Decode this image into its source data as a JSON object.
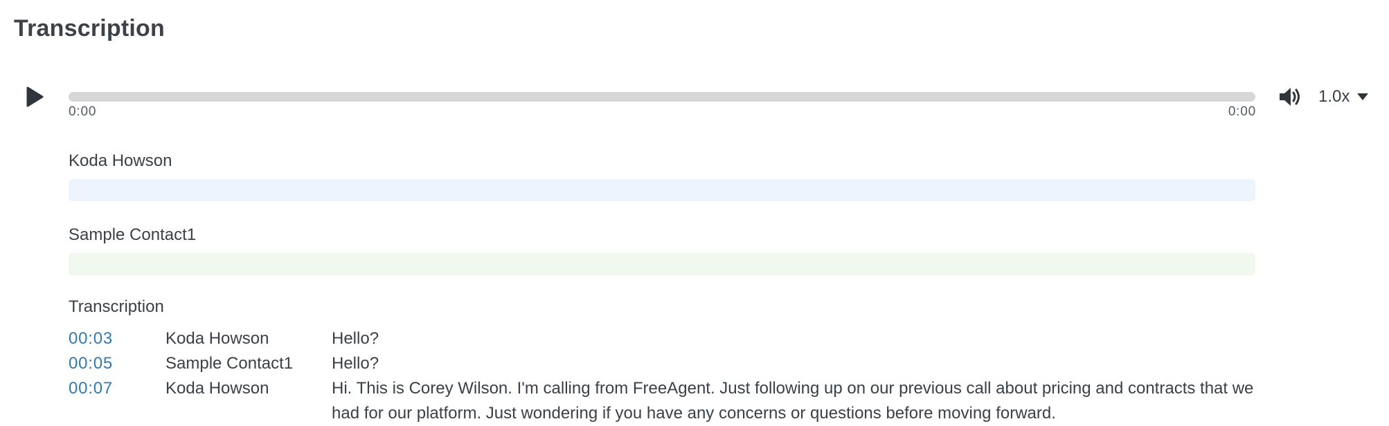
{
  "page": {
    "title": "Transcription"
  },
  "player": {
    "progress_fraction": 0,
    "current_time": "0:00",
    "duration": "0:00",
    "speed": "1.0x",
    "play_icon": "play-icon",
    "volume_icon": "volume-icon",
    "dropdown_icon": "caret-down-icon"
  },
  "speakers": [
    {
      "name": "Koda Howson",
      "color": "#edf4fd"
    },
    {
      "name": "Sample Contact1",
      "color": "#f1f9ee"
    }
  ],
  "transcript": {
    "heading": "Transcription",
    "rows": [
      {
        "time": "00:03",
        "speaker": "Koda Howson",
        "text": "Hello?"
      },
      {
        "time": "00:05",
        "speaker": "Sample Contact1",
        "text": "Hello?"
      },
      {
        "time": "00:07",
        "speaker": "Koda Howson",
        "text": "Hi. This is Corey Wilson. I'm calling from FreeAgent. Just following up on our previous call about pricing and contracts that we had for our platform. Just wondering if you have any concerns or questions before moving forward."
      }
    ]
  },
  "colors": {
    "accent": "#2e7ab8",
    "track": "#d6d6d6",
    "text": "#3a4048"
  }
}
